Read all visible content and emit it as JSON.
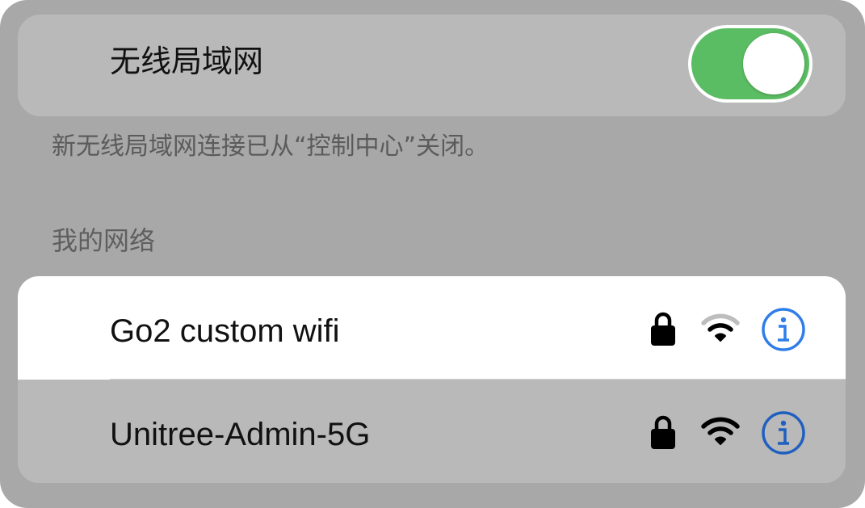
{
  "wlan": {
    "label": "无线局域网",
    "enabled": true,
    "toggle_color": "#5bbd63"
  },
  "note": "新无线局域网连接已从“控制中心”关闭。",
  "section_header": "我的网络",
  "networks": [
    {
      "name": "Go2 custom wifi",
      "secured": true,
      "icons": [
        "lock-icon",
        "wifi-icon",
        "info-icon"
      ]
    },
    {
      "name": "Unitree-Admin-5G",
      "secured": true,
      "icons": [
        "lock-icon",
        "wifi-icon",
        "info-icon"
      ]
    }
  ],
  "colors": {
    "info_accent": "#2f7ee8",
    "selected_row": "#ffffff"
  }
}
